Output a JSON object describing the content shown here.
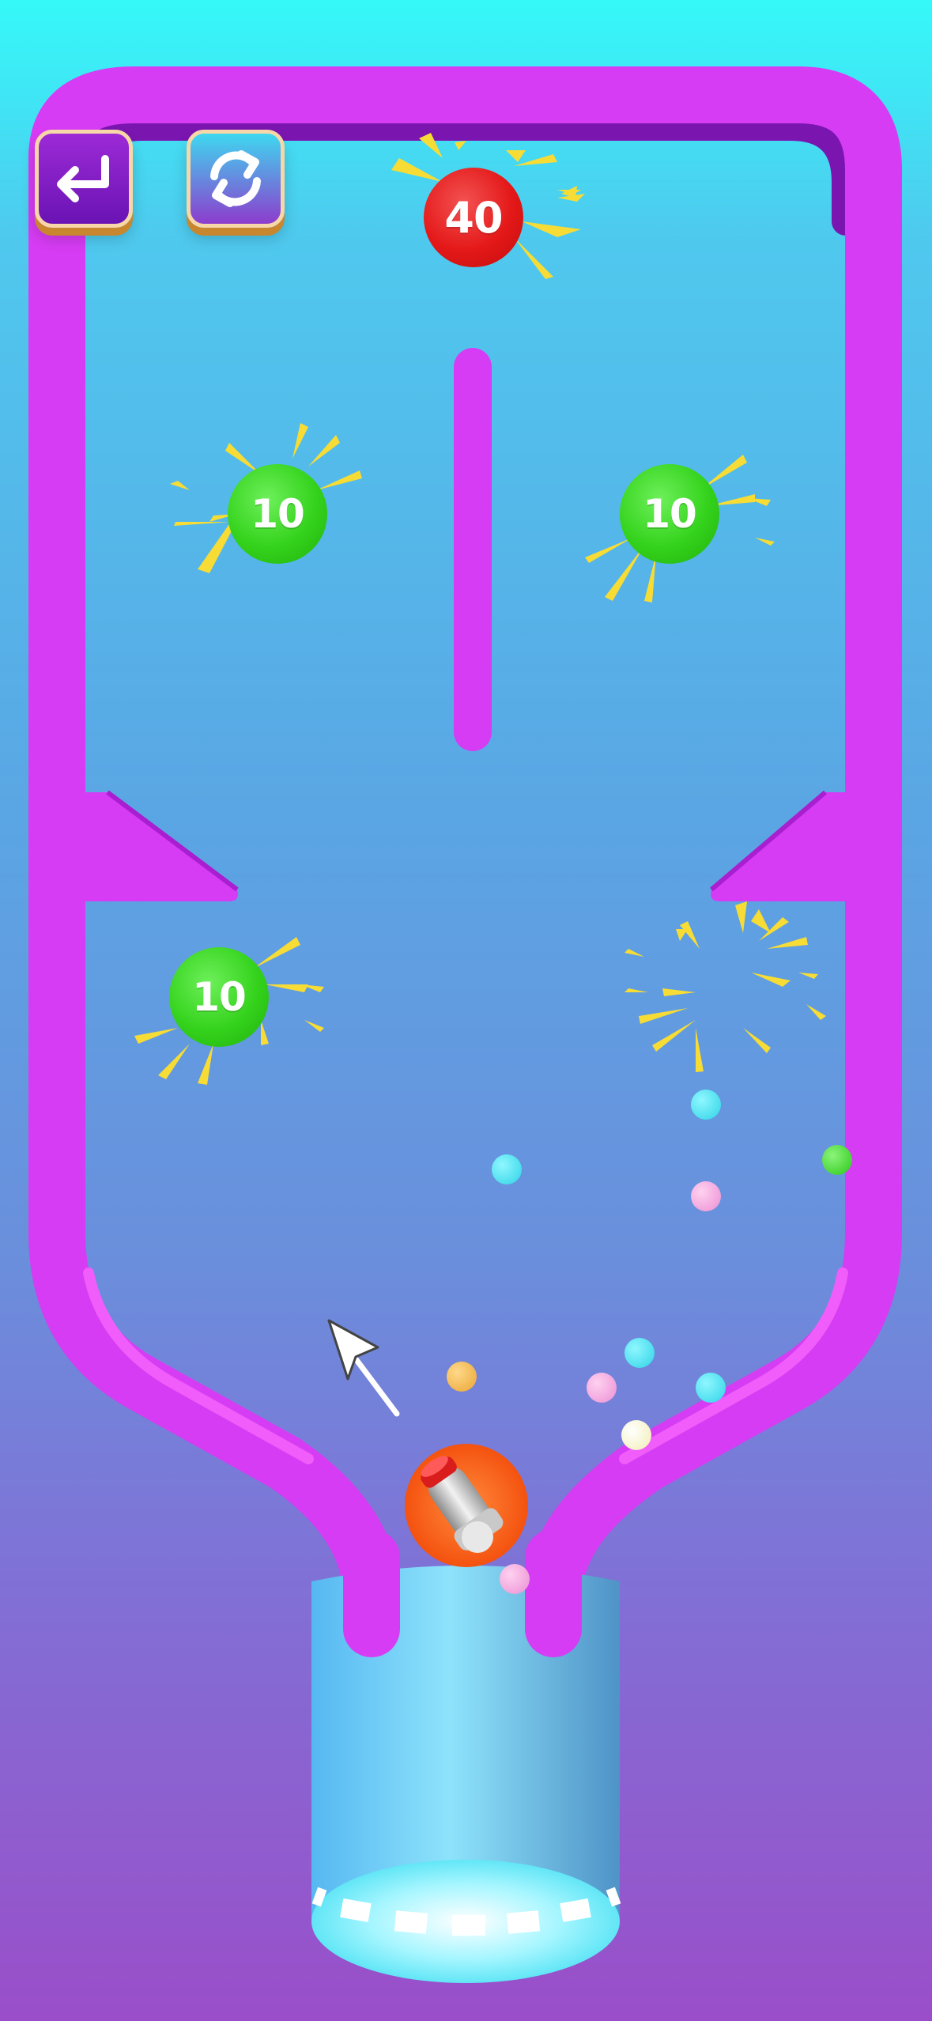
{
  "header": {
    "back_button": {
      "icon": "return-arrow-icon"
    },
    "restart_button": {
      "icon": "refresh-icon"
    }
  },
  "targets": [
    {
      "id": "top-red",
      "label": "40",
      "color": "red"
    },
    {
      "id": "upper-left",
      "label": "10",
      "color": "green"
    },
    {
      "id": "upper-right",
      "label": "10",
      "color": "green"
    },
    {
      "id": "lower-left",
      "label": "10",
      "color": "green"
    }
  ],
  "aim_hint": {
    "icon": "aim-arrow-icon"
  },
  "cannon": {
    "icon": "cannon-icon"
  },
  "colors": {
    "frame": "#d63cf3",
    "frame_dark": "#7a15b0",
    "green_ball": "#34d21c",
    "red_ball": "#e41818",
    "spark": "#f7dc35",
    "cannon_base": "#f96a1c"
  }
}
